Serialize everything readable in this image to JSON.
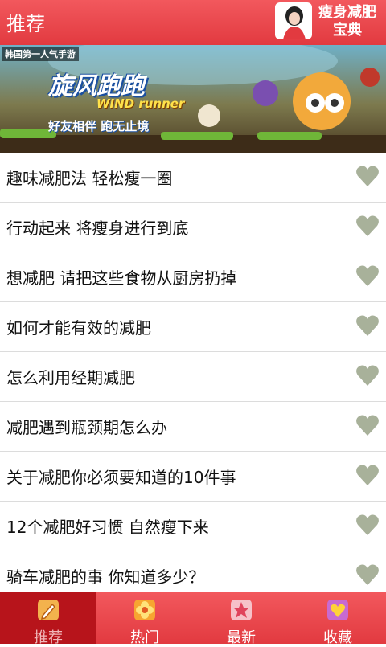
{
  "header": {
    "title": "推荐",
    "app_name": "瘦身减肥宝典"
  },
  "banner": {
    "tagline": "韩国第一人气手游",
    "game_title": "旋风跑跑",
    "game_sub": "WIND runner",
    "game_slogan": "好友相伴 跑无止境"
  },
  "articles": [
    {
      "title": "趣味减肥法 轻松瘦一圈"
    },
    {
      "title": "行动起来 将瘦身进行到底"
    },
    {
      "title": "想减肥 请把这些食物从厨房扔掉"
    },
    {
      "title": "如何才能有效的减肥"
    },
    {
      "title": "怎么利用经期减肥"
    },
    {
      "title": "减肥遇到瓶颈期怎么办"
    },
    {
      "title": "关于减肥你必须要知道的10件事"
    },
    {
      "title": "12个减肥好习惯 自然瘦下来"
    },
    {
      "title": "骑车减肥的事 你知道多少？"
    }
  ],
  "tabs": [
    {
      "label": "推荐",
      "icon": "pencil-icon",
      "active": true
    },
    {
      "label": "热门",
      "icon": "flower-icon",
      "active": false
    },
    {
      "label": "最新",
      "icon": "star-icon",
      "active": false
    },
    {
      "label": "收藏",
      "icon": "favorite-icon",
      "active": false
    }
  ],
  "colors": {
    "accent": "#e63e44",
    "heart": "#a8b19a",
    "active_tab": "#b7141b"
  }
}
